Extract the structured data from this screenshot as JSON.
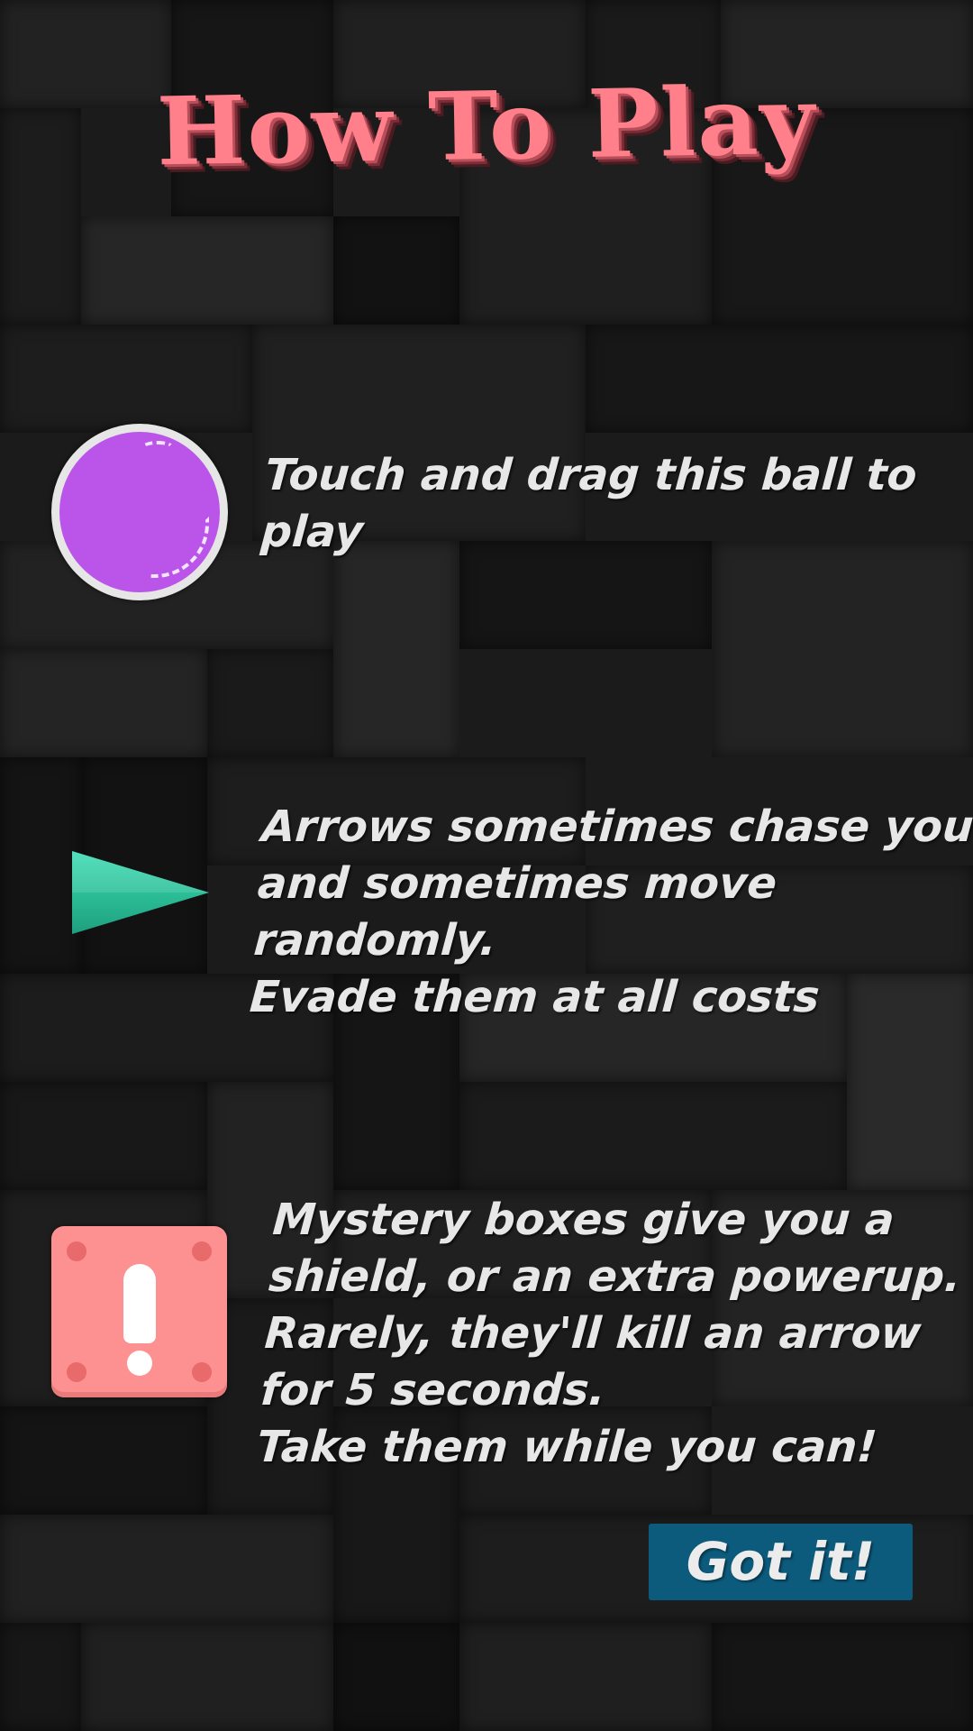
{
  "screen": {
    "title": "How To Play"
  },
  "instructions": [
    {
      "icon": "purple-ball-icon",
      "text": "Touch and drag this ball to\nplay"
    },
    {
      "icon": "green-arrow-icon",
      "text": "Arrows sometimes chase you\nand sometimes move randomly.\nEvade them at all costs"
    },
    {
      "icon": "mystery-box-icon",
      "text": "Mystery boxes give you a\nshield, or an extra powerup.\nRarely, they'll kill an arrow\nfor 5 seconds.\nTake them while you can!"
    }
  ],
  "actions": {
    "confirm_label": "Got it!"
  },
  "colors": {
    "title": "#ff7f8a",
    "ball": "#bb55ea",
    "arrow": "#2ec4a0",
    "mystery_box": "#fd9090",
    "button": "#0c5a7c",
    "background": "#1b1b1b"
  }
}
